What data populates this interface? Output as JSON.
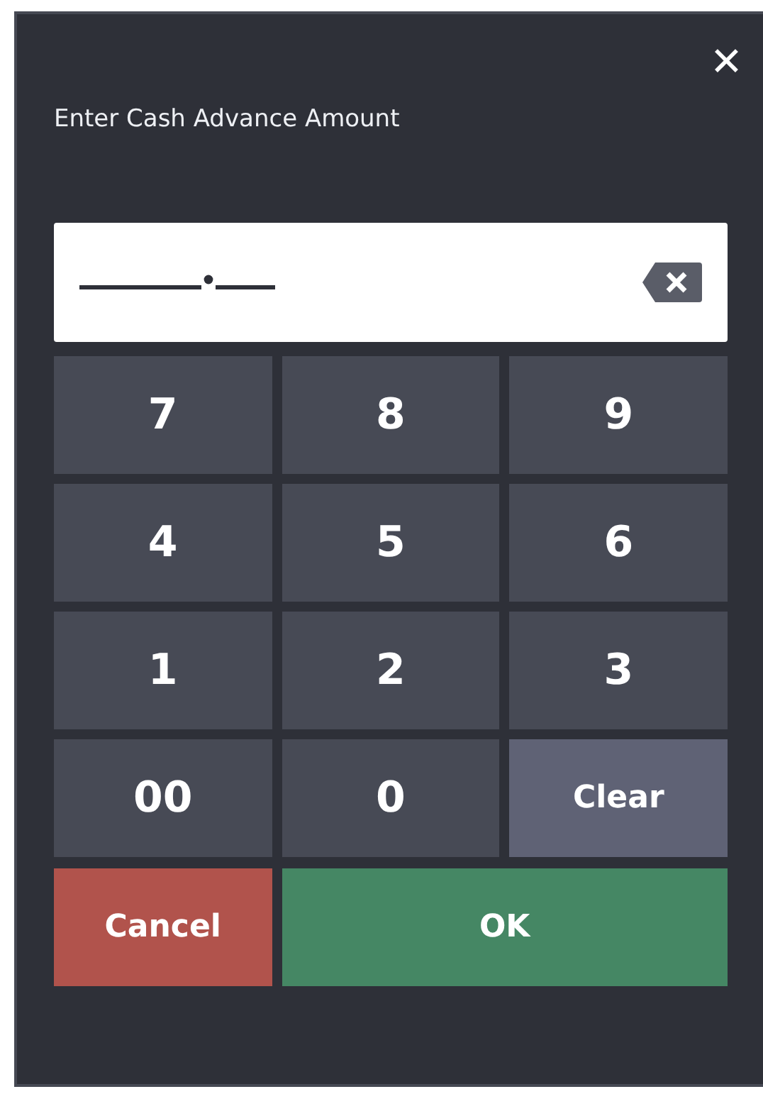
{
  "dialog": {
    "title": "Enter Cash Advance Amount",
    "close": "✕"
  },
  "keypad": [
    {
      "label": "7",
      "kind": "digit"
    },
    {
      "label": "8",
      "kind": "digit"
    },
    {
      "label": "9",
      "kind": "digit"
    },
    {
      "label": "4",
      "kind": "digit"
    },
    {
      "label": "5",
      "kind": "digit"
    },
    {
      "label": "6",
      "kind": "digit"
    },
    {
      "label": "1",
      "kind": "digit"
    },
    {
      "label": "2",
      "kind": "digit"
    },
    {
      "label": "3",
      "kind": "digit"
    },
    {
      "label": "00",
      "kind": "digit"
    },
    {
      "label": "0",
      "kind": "digit"
    },
    {
      "label": "Clear",
      "kind": "clear"
    }
  ],
  "actions": [
    {
      "label": "Cancel",
      "kind": "cancel"
    },
    {
      "label": "OK",
      "kind": "ok"
    }
  ]
}
